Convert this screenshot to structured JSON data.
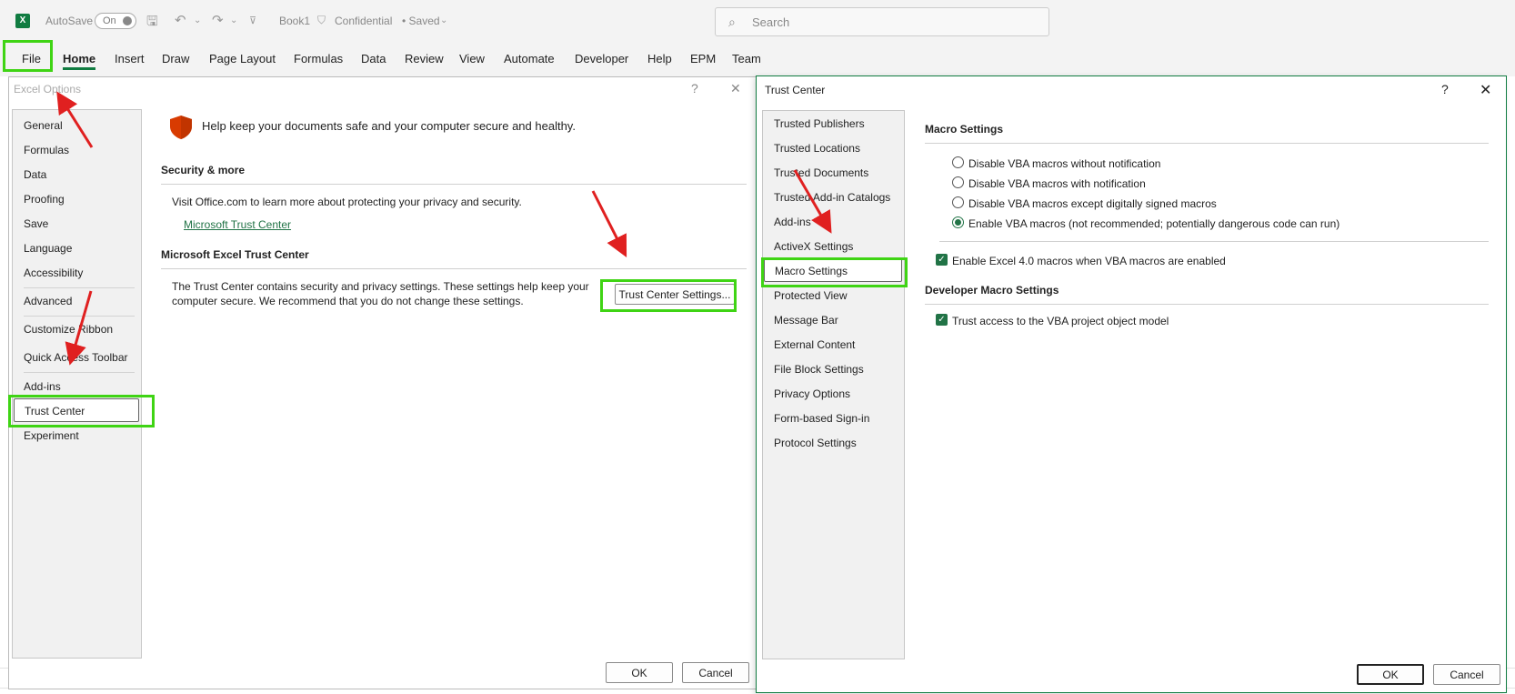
{
  "titlebar": {
    "autosave_label": "AutoSave",
    "autosave_state": "On",
    "book_name": "Book1",
    "sensitivity": "Confidential",
    "save_state": "• Saved",
    "search_placeholder": "Search"
  },
  "ribbon": {
    "tabs": [
      "File",
      "Home",
      "Insert",
      "Draw",
      "Page Layout",
      "Formulas",
      "Data",
      "Review",
      "View",
      "Automate",
      "Developer",
      "Help",
      "EPM",
      "Team"
    ],
    "active_tab": "Home"
  },
  "excel_options": {
    "title": "Excel Options",
    "help": "?",
    "close": "✕",
    "nav": [
      "General",
      "Formulas",
      "Data",
      "Proofing",
      "Save",
      "Language",
      "Accessibility",
      "Advanced",
      "Customize Ribbon",
      "Quick Access Toolbar",
      "Add-ins",
      "Trust Center",
      "Experiment"
    ],
    "selected_nav": "Trust Center",
    "banner": "Help keep your documents safe and your computer secure and healthy.",
    "security_heading": "Security & more",
    "security_text": "Visit Office.com to learn more about protecting your privacy and security.",
    "security_link": "Microsoft Trust Center",
    "tc_heading": "Microsoft Excel Trust Center",
    "tc_text": "The Trust Center contains security and privacy settings. These settings help keep your computer secure. We recommend that you do not change these settings.",
    "tc_button": "Trust Center Settings...",
    "ok": "OK",
    "cancel": "Cancel"
  },
  "trust_center": {
    "title": "Trust Center",
    "help": "?",
    "close": "✕",
    "nav": [
      "Trusted Publishers",
      "Trusted Locations",
      "Trusted Documents",
      "Trusted Add-in Catalogs",
      "Add-ins",
      "ActiveX Settings",
      "Macro Settings",
      "Protected View",
      "Message Bar",
      "External Content",
      "File Block Settings",
      "Privacy Options",
      "Form-based Sign-in",
      "Protocol Settings"
    ],
    "selected_nav": "Macro Settings",
    "macro_heading": "Macro Settings",
    "macro_options": [
      "Disable VBA macros without notification",
      "Disable VBA macros with notification",
      "Disable VBA macros except digitally signed macros",
      "Enable VBA macros (not recommended; potentially dangerous code can run)"
    ],
    "selected_macro_option": 3,
    "excel4_label": "Enable Excel 4.0 macros when VBA macros are enabled",
    "excel4_checked": true,
    "dev_heading": "Developer Macro Settings",
    "vba_access_label": "Trust access to the VBA project object model",
    "vba_access_checked": true,
    "ok": "OK",
    "cancel": "Cancel"
  },
  "colors": {
    "accent": "#217346",
    "excel_green": "#107c41",
    "highlight": "#3fd414",
    "arrow": "#e02020"
  }
}
